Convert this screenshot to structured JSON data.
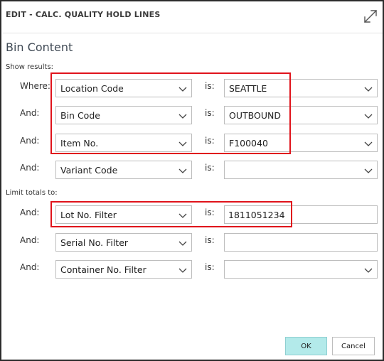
{
  "dialog": {
    "title": "EDIT - CALC. QUALITY HOLD LINES",
    "page_title": "Bin Content",
    "expand_icon": "expand-arrows-icon"
  },
  "show_results": {
    "label": "Show results:",
    "rows": [
      {
        "prefix": "Where:",
        "field": "Location Code",
        "is": "is:",
        "value": "SEATTLE",
        "value_dropdown": true
      },
      {
        "prefix": "And:",
        "field": "Bin Code",
        "is": "is:",
        "value": "OUTBOUND",
        "value_dropdown": true
      },
      {
        "prefix": "And:",
        "field": "Item No.",
        "is": "is:",
        "value": "F100040",
        "value_dropdown": true
      },
      {
        "prefix": "And:",
        "field": "Variant Code",
        "is": "is:",
        "value": "",
        "value_dropdown": true
      }
    ]
  },
  "limit_totals": {
    "label": "Limit totals to:",
    "rows": [
      {
        "prefix": "And:",
        "field": "Lot No. Filter",
        "is": "is:",
        "value": "1811051234",
        "value_dropdown": false
      },
      {
        "prefix": "And:",
        "field": "Serial No. Filter",
        "is": "is:",
        "value": "",
        "value_dropdown": false
      },
      {
        "prefix": "And:",
        "field": "Container No. Filter",
        "is": "is:",
        "value": "",
        "value_dropdown": true
      }
    ]
  },
  "buttons": {
    "ok": "OK",
    "cancel": "Cancel"
  },
  "colors": {
    "highlight": "#e0131b",
    "ok_button": "#b3eaea"
  }
}
